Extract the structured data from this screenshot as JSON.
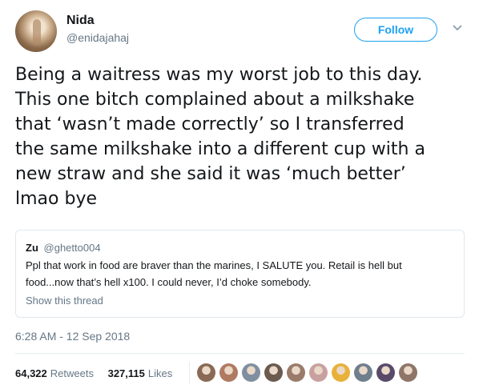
{
  "author": {
    "name": "Nida",
    "handle": "@enidajahaj"
  },
  "follow_label": "Follow",
  "tweet_text": "Being a waitress was my worst job to this day.\nThis one bitch complained about a milkshake\nthat ‘wasn’t made correctly’ so I transferred\nthe same milkshake into a different cup with a\nnew straw and she said it was ‘much better’\nlmao bye",
  "quoted_tweet": {
    "name": "Zu",
    "handle": "@ghetto004",
    "text": "Ppl that work in food are braver than the marines, I SALUTE you. Retail is hell but\nfood...now that’s hell x100. I could never, I’d choke somebody.",
    "show_thread_label": "Show this thread"
  },
  "timestamp": "6:28 AM - 12 Sep 2018",
  "stats": {
    "retweets_count": "64,322",
    "retweets_label": "Retweets",
    "likes_count": "327,115",
    "likes_label": "Likes"
  },
  "likers": [
    {
      "color": "#8a6a55"
    },
    {
      "color": "#b07a62"
    },
    {
      "color": "#7f8fa0"
    },
    {
      "color": "#6b5a4e"
    },
    {
      "color": "#9a7b6b"
    },
    {
      "color": "#c9a0a0"
    },
    {
      "color": "#e8b13a"
    },
    {
      "color": "#6f7f8e"
    },
    {
      "color": "#5a4a6a"
    },
    {
      "color": "#8e7568"
    }
  ]
}
